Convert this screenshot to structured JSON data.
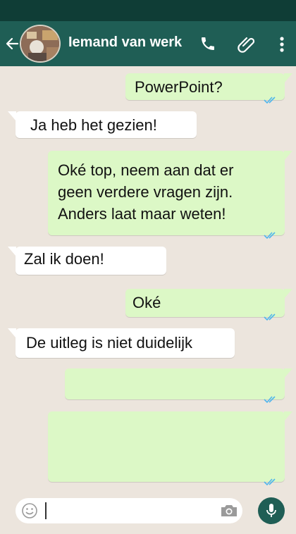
{
  "header": {
    "contact_name": "Iemand van werk",
    "icons": [
      "back-arrow-icon",
      "contact-avatar",
      "phone-icon",
      "paperclip-icon",
      "more-vert-icon"
    ]
  },
  "messages": [
    {
      "direction": "outgoing",
      "text": "PowerPoint?",
      "status": "read"
    },
    {
      "direction": "incoming",
      "text": "Ja heb het gezien!"
    },
    {
      "direction": "outgoing",
      "lines": [
        "Oké top, neem aan dat er",
        "geen verdere vragen zijn.",
        "Anders laat maar weten!"
      ],
      "status": "read"
    },
    {
      "direction": "incoming",
      "text": "Zal ik doen!"
    },
    {
      "direction": "outgoing",
      "text": "Oké",
      "status": "read"
    },
    {
      "direction": "incoming",
      "text": "De uitleg is niet duidelijk"
    },
    {
      "direction": "outgoing",
      "text": "",
      "status": "read"
    },
    {
      "direction": "outgoing",
      "text": "",
      "status": "read"
    }
  ],
  "composer": {
    "value": "",
    "icons": [
      "emoji-icon",
      "camera-icon",
      "microphone-icon"
    ]
  },
  "colors": {
    "header": "#1f5e55",
    "status_bar": "#0f3d36",
    "chat_background": "#ece5dd",
    "outgoing_bubble": "#dcf8c6",
    "incoming_bubble": "#ffffff",
    "read_ticks": "#4fb6ec"
  }
}
